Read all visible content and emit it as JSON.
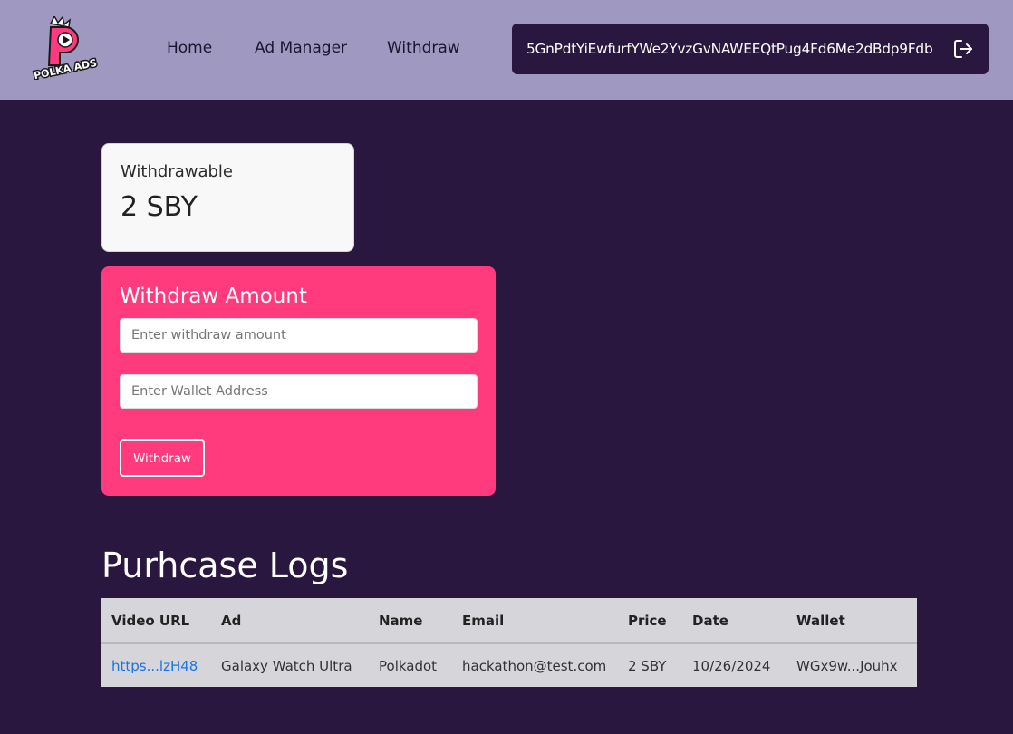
{
  "navbar": {
    "logo_text": "POLKA ADS",
    "links": [
      {
        "label": "Home"
      },
      {
        "label": "Ad Manager"
      },
      {
        "label": "Withdraw"
      }
    ],
    "wallet_address": "5GnPdtYiEwfurfYWe2YvzGvNAWEEQtPug4Fd6Me2dBdp9Fdb",
    "logout_icon": "logout-icon"
  },
  "balance": {
    "label": "Withdrawable",
    "value": "2 SBY"
  },
  "withdraw_form": {
    "title": "Withdraw Amount",
    "amount_placeholder": "Enter withdraw amount",
    "amount_value": "",
    "wallet_placeholder": "Enter Wallet Address",
    "wallet_value": "",
    "submit_label": "Withdraw"
  },
  "logs": {
    "title": "Purhcase Logs",
    "columns": [
      "Video URL",
      "Ad",
      "Name",
      "Email",
      "Price",
      "Date",
      "Wallet"
    ],
    "rows": [
      {
        "video_url": "https...lzH48",
        "ad": "Galaxy Watch Ultra",
        "name": "Polkadot",
        "email": "hackathon@test.com",
        "price": "2 SBY",
        "date": "10/26/2024",
        "wallet": "WGx9w...Jouhx"
      }
    ]
  },
  "colors": {
    "background": "#2a173f",
    "navbar": "#9f98c0",
    "accent_pink": "#ff3a7d",
    "link_blue": "#1a73e8"
  }
}
